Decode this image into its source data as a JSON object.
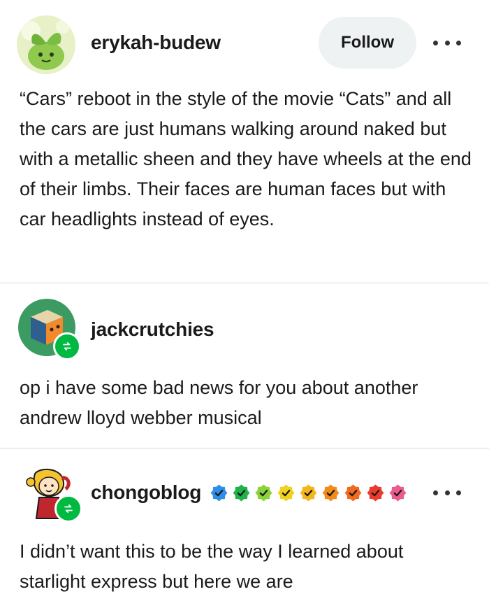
{
  "posts": [
    {
      "username": "erykah-budew",
      "follow_label": "Follow",
      "text": "“Cars” reboot in the style of the movie “Cats” and all the cars are just humans walking around naked but with a metallic sheen and they have wheels at the end of their limbs. Their faces are human faces but with car headlights instead of eyes."
    },
    {
      "username": "jackcrutchies",
      "text": "op i have some bad news for you about another andrew lloyd webber musical"
    },
    {
      "username": "chongoblog",
      "text": "I didn’t want this to be the way I learned about starlight express but here we are"
    }
  ],
  "verified_badge_colors": [
    "#2f8fe6",
    "#1fb24a",
    "#8bd33a",
    "#f0d020",
    "#f5b51f",
    "#f28a1c",
    "#f06a1f",
    "#ea3b2c",
    "#ec5a8f"
  ],
  "colors": {
    "reblog_badge": "#00b940",
    "follow_button_bg": "#eef2f2",
    "divider": "#d9d9d9"
  },
  "icons": {
    "more": "more-horizontal-icon",
    "reblog": "reblog-icon",
    "verified": "verified-badge-icon"
  }
}
